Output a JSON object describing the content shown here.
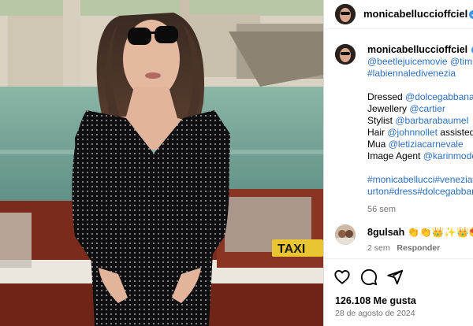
{
  "post": {
    "username": "monicabelluccioffciel",
    "image_text": "TAXI"
  },
  "caption": {
    "username": "monicabelluccioffciel",
    "line1_tail": "",
    "line2": "@beetlejuicemovie @timb",
    "line3": "#labiennaledivenezia",
    "dressed_label": "Dressed",
    "dressed_value": "@dolcegabbana",
    "jewellery_label": "Jewellery",
    "jewellery_value": "@cartier",
    "stylist_label": "Stylist",
    "stylist_value": "@barbarabaumel",
    "hair_label": "Hair",
    "hair_value": "@johnnollet",
    "hair_tail": "assisted b",
    "mua_label": "Mua",
    "mua_value": "@letiziacarnevale",
    "agent_label": "Image Agent",
    "agent_value": "@karinmode",
    "hashtags1": "#monicabellucci#venezia#",
    "hashtags2": "urton#dress#dolcegabbana",
    "time": "56 sem"
  },
  "comment": {
    "username": "8gulsah",
    "emojis": "👏👏👑✨👑😍",
    "time": "2 sem",
    "reply": "Responder"
  },
  "actions": {
    "likes": "126.108 Me gusta",
    "date": "28 de agosto de 2024"
  },
  "colors": {
    "verified": "#3897f0",
    "link": "#2f6fc0",
    "taxi_yellow": "#e9c531"
  },
  "icons": [
    "heart-icon",
    "comment-icon",
    "share-icon",
    "verified-icon",
    "more-icon"
  ]
}
